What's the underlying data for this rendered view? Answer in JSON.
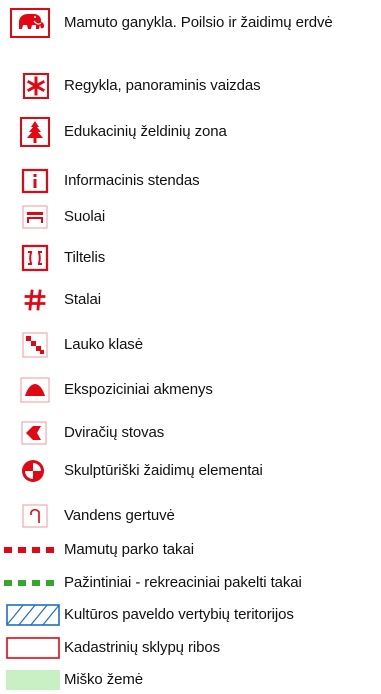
{
  "legend": {
    "colors": {
      "red": "#e30613",
      "green": "#35a82b",
      "blue": "#1f6fc1",
      "forest_fill": "#c9f0c4",
      "text": "#111111"
    },
    "items": [
      {
        "icon": "mammoth-icon",
        "label": "Mamuto ganykla. Poilsio ir žaidimų erdvė"
      },
      {
        "icon": "asterisk-icon",
        "label": "Regykla, panoraminis vaizdas"
      },
      {
        "icon": "fir-tree-icon",
        "label": "Edukacinių želdinių zona"
      },
      {
        "icon": "info-icon",
        "label": "Informacinis stendas"
      },
      {
        "icon": "bench-icon",
        "label": "Suolai"
      },
      {
        "icon": "bridge-icon",
        "label": "Tiltelis"
      },
      {
        "icon": "hash-icon",
        "label": "Stalai"
      },
      {
        "icon": "checker-icon",
        "label": "Lauko klasė"
      },
      {
        "icon": "mound-icon",
        "label": "Ekspoziciniai akmenys"
      },
      {
        "icon": "bike-stand-icon",
        "label": "Dviračių stovas"
      },
      {
        "icon": "quadrant-circle-icon",
        "label": "Skulptūriški žaidimų elementai"
      },
      {
        "icon": "fountain-icon",
        "label": "Vandens gertuvė"
      },
      {
        "icon": "red-dashed-line",
        "label": "Mamutų parko takai"
      },
      {
        "icon": "green-dashed-line",
        "label": "Pažintiniai - rekreaciniai pakelti takai"
      },
      {
        "icon": "blue-hatched-area",
        "label": "Kultūros paveldo vertybių teritorijos"
      },
      {
        "icon": "red-outline-area",
        "label": "Kadastrinių sklypų ribos"
      },
      {
        "icon": "green-fill-area",
        "label": "Miško žemė"
      }
    ]
  }
}
